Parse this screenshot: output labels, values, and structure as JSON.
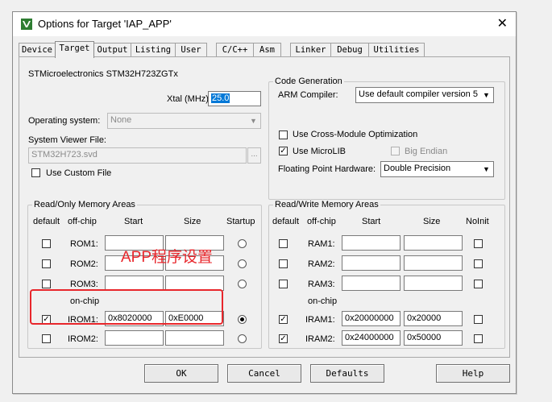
{
  "window": {
    "title": "Options for Target 'IAP_APP'",
    "close_glyph": "✕"
  },
  "tabs": [
    "Device",
    "Target",
    "Output",
    "Listing",
    "User",
    "C/C++",
    "Asm",
    "Linker",
    "Debug",
    "Utilities"
  ],
  "active_tab": "Target",
  "device": {
    "name": "STMicroelectronics STM32H723ZGTx",
    "xtal_label": "Xtal (MHz):",
    "xtal_value": "25.0",
    "os_label": "Operating system:",
    "os_value": "None",
    "svd_label": "System Viewer File:",
    "svd_value": "STM32H723.svd",
    "browse_label": "...",
    "custom_file_label": "Use Custom File"
  },
  "codegen": {
    "group_title": "Code Generation",
    "compiler_label": "ARM Compiler:",
    "compiler_value": "Use default compiler version 5",
    "cross_module_label": "Use Cross-Module Optimization",
    "microlib_label": "Use MicroLIB",
    "big_endian_label": "Big Endian",
    "fph_label": "Floating Point Hardware:",
    "fph_value": "Double Precision"
  },
  "rom": {
    "group_title": "Read/Only Memory Areas",
    "headers": {
      "default": "default",
      "offchip": "off-chip",
      "start": "Start",
      "size": "Size",
      "startup": "Startup"
    },
    "onchip_label": "on-chip",
    "rows": [
      {
        "name": "ROM1:",
        "start": "",
        "size": "",
        "default": false,
        "startup": false
      },
      {
        "name": "ROM2:",
        "start": "",
        "size": "",
        "default": false,
        "startup": false
      },
      {
        "name": "ROM3:",
        "start": "",
        "size": "",
        "default": false,
        "startup": false
      },
      {
        "name": "IROM1:",
        "start": "0x8020000",
        "size": "0xE0000",
        "default": true,
        "startup": true
      },
      {
        "name": "IROM2:",
        "start": "",
        "size": "",
        "default": false,
        "startup": false
      }
    ]
  },
  "ram": {
    "group_title": "Read/Write Memory Areas",
    "headers": {
      "default": "default",
      "offchip": "off-chip",
      "start": "Start",
      "size": "Size",
      "noinit": "NoInit"
    },
    "onchip_label": "on-chip",
    "rows": [
      {
        "name": "RAM1:",
        "start": "",
        "size": "",
        "default": false,
        "noinit": false
      },
      {
        "name": "RAM2:",
        "start": "",
        "size": "",
        "default": false,
        "noinit": false
      },
      {
        "name": "RAM3:",
        "start": "",
        "size": "",
        "default": false,
        "noinit": false
      },
      {
        "name": "IRAM1:",
        "start": "0x20000000",
        "size": "0x20000",
        "default": true,
        "noinit": false
      },
      {
        "name": "IRAM2:",
        "start": "0x24000000",
        "size": "0x50000",
        "default": true,
        "noinit": false
      }
    ]
  },
  "annotation": {
    "text": "APP程序设置",
    "color": "#e8262b"
  },
  "buttons": {
    "ok": "OK",
    "cancel": "Cancel",
    "defaults": "Defaults",
    "help": "Help"
  },
  "colors": {
    "accent": "#0078d7"
  }
}
